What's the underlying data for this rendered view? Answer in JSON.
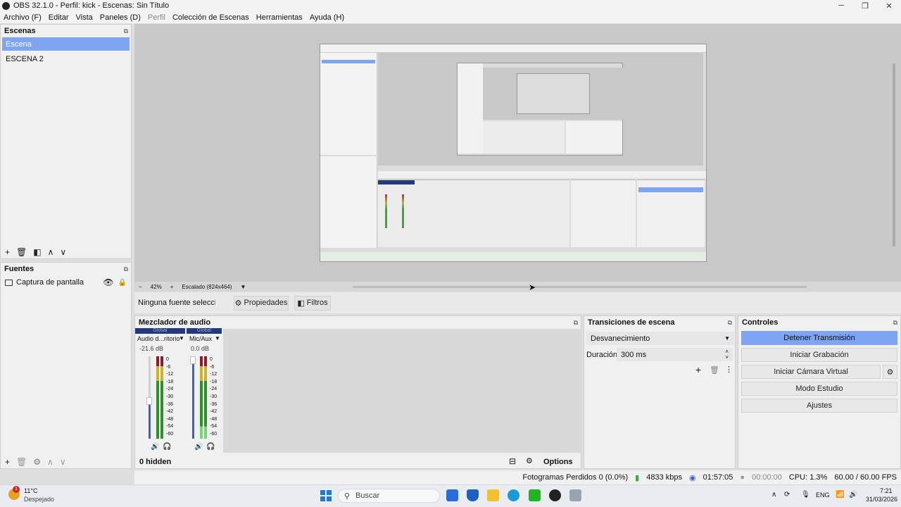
{
  "window": {
    "title": "OBS 32.1.0 - Perfil: kick - Escenas: Sin Título",
    "min": "─",
    "max": "❐",
    "close": "✕"
  },
  "menu": [
    "Archivo (F)",
    "Editar",
    "Vista",
    "Paneles (D)",
    "Perfil",
    "Colección de Escenas",
    "Herramientas",
    "Ayuda (H)"
  ],
  "scenes": {
    "title": "Escenas",
    "items": [
      "Escena",
      "ESCENA 2"
    ]
  },
  "sources": {
    "title": "Fuentes",
    "items": [
      {
        "name": "Captura de pantalla"
      }
    ]
  },
  "preview": {
    "zoom": "42%",
    "scale": "Escalado (824x464)"
  },
  "context": {
    "no_source": "Ninguna fuente seleccionad",
    "properties": "Propiedades",
    "filters": "Filtros"
  },
  "mixer": {
    "title": "Mezclador de audio",
    "channels": [
      {
        "tag": "Global",
        "name": "Audio d...ritorio",
        "db": "-21.6 dB"
      },
      {
        "tag": "Global",
        "name": "Mic/Aux",
        "db": "0.0 dB"
      }
    ],
    "scale": [
      "0",
      "-6",
      "-12",
      "-18",
      "-24",
      "-30",
      "-36",
      "-42",
      "-48",
      "-54",
      "-60"
    ],
    "hidden": "0 hidden",
    "options": "Options"
  },
  "transitions": {
    "title": "Transiciones de escena",
    "selected": "Desvanecimiento",
    "duration_label": "Duración",
    "duration_value": "300 ms"
  },
  "controls": {
    "title": "Controles",
    "buttons": [
      "Detener Transmisión",
      "Iniciar Grabación",
      "Iniciar Cámara Virtual",
      "Modo Estudio",
      "Ajustes"
    ]
  },
  "status": {
    "dropped": "Fotogramas Perdidos 0 (0.0%)",
    "kbps": "4833 kbps",
    "stream_time": "01:57:05",
    "rec_time": "00:00:00",
    "cpu": "CPU: 1.3%",
    "fps": "60.00 / 60.00 FPS"
  },
  "taskbar": {
    "temp": "11°C",
    "weather": "Despejado",
    "search": "Buscar",
    "lang": "ENG",
    "time": "7:21",
    "date": "31/03/2026",
    "badge": "1"
  },
  "colors": {
    "accent": "#7ea4f2",
    "meter_green": "#3aa83a",
    "meter_yellow": "#c8b428",
    "meter_red": "#b8283a",
    "volume_blue": "#3d5fc8"
  }
}
